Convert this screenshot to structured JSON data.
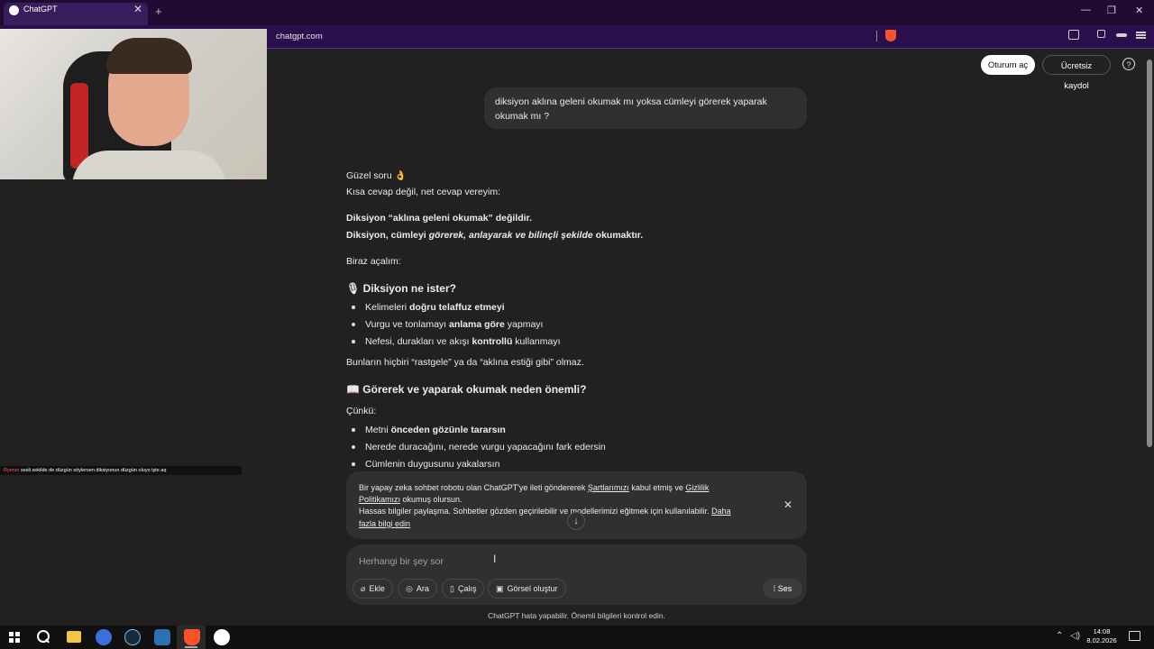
{
  "browser": {
    "tab_title": "ChatGPT",
    "tab_close": "✕",
    "new_tab": "+",
    "url": "chatgpt.com",
    "window_controls": [
      "—",
      "❐",
      "✕"
    ]
  },
  "stream_chat": {
    "nick": "Ryeno",
    "message": ": sesli sekilde de düzgün söylersen diksiyonun düzgün oluyo işte aq"
  },
  "header": {
    "login_label": "Oturum aç",
    "signup_label": "Ücretsiz kaydol",
    "help_icon": "?"
  },
  "user_message": "diksiyon aklına geleni okumak mı yoksa cümleyi görerek yaparak okumak mı ?",
  "response": {
    "intro1": "Güzel soru 👌",
    "intro2": "Kısa cevap değil, net cevap vereyim:",
    "bold1": "Diksiyon “aklına geleni okumak” değildir.",
    "line2_a": "Diksiyon, cümleyi ",
    "line2_b": "görerek, anlayarak ve bilinçli şekilde",
    "line2_c": " okumaktır.",
    "explain": "Biraz açalım:",
    "h1_icon": "🎙",
    "h1": "Diksiyon ne ister?",
    "list1": [
      {
        "pre": "Kelimeleri ",
        "bold": "doğru telaffuz etmeyi",
        "post": ""
      },
      {
        "pre": "Vurgu ve tonlamayı ",
        "bold": "anlama göre",
        "post": " yapmayı"
      },
      {
        "pre": "Nefesi, durakları ve akışı ",
        "bold": "kontrollü",
        "post": " kullanmayı"
      }
    ],
    "summary": "Bunların hiçbiri “rastgele” ya da “aklına estiği gibi” olmaz.",
    "h2_icon": "📖",
    "h2": "Görerek ve yaparak okumak neden önemli?",
    "because": "Çünkü:",
    "list2": [
      {
        "pre": "Metni ",
        "bold": "önceden gözünle tararsın",
        "post": ""
      },
      {
        "pre": "Nerede duracağını, nerede vurgu yapacağını fark edersin",
        "bold": "",
        "post": ""
      },
      {
        "pre": "Cümlenin duygusunu yakalarsın",
        "bold": "",
        "post": ""
      }
    ]
  },
  "consent": {
    "t1": "Bir yapay zeka sohbet robotu olan ChatGPT'ye ileti göndererek ",
    "terms": "Şartlarımızı",
    "t2": " kabul etmiş ve ",
    "privacy": "Gizlilik Politikamızı",
    "t3": " okumuş olursun.",
    "t4": "Hassas bilgiler paylaşma. Sohbetler gözden geçirilebilir ve modellerimizi eğitmek için kullanılabilir. ",
    "more": "Daha fazla bilgi edin",
    "close": "✕",
    "scroll": "↓"
  },
  "composer": {
    "placeholder": "Herhangi bir şey sor",
    "chips": [
      "Ekle",
      "Ara",
      "Çalış",
      "Görsel oluştur"
    ],
    "voice": "Ses",
    "disclaimer": "ChatGPT hata yapabilir. Önemli bilgileri kontrol edin."
  },
  "taskbar": {
    "time": "14:08",
    "date": "8.02.2026"
  },
  "colors": {
    "page_bg": "#212121",
    "bubble_bg": "#303030",
    "browser_frame": "#2b0f4d",
    "brave_orange": "#fb542b"
  }
}
